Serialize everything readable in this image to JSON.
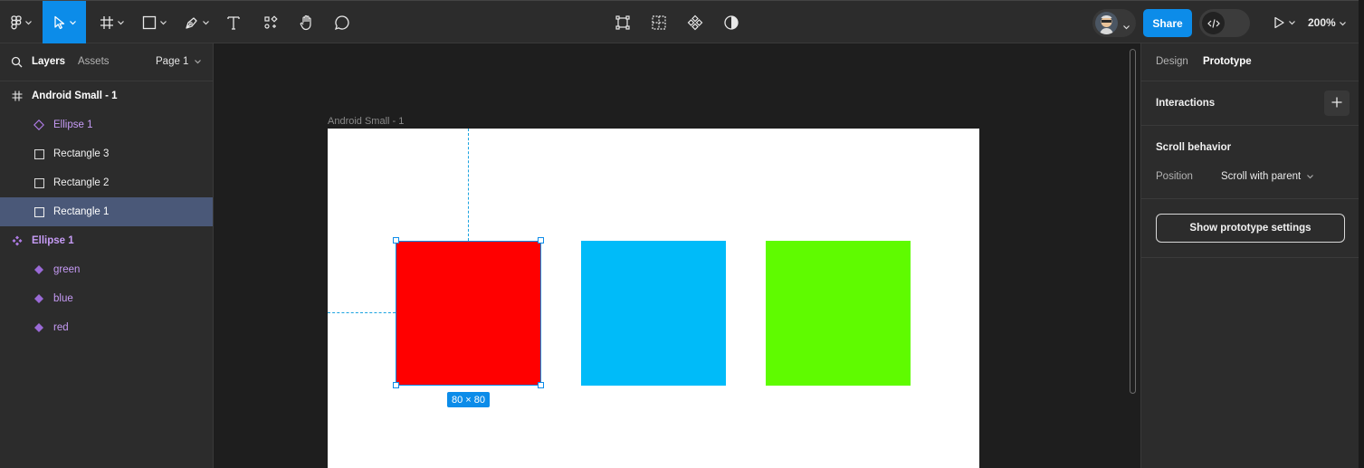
{
  "toolbar": {
    "share_label": "Share",
    "zoom_label": "200%",
    "accent": "#0c8ce9"
  },
  "left_panel": {
    "tab_layers": "Layers",
    "tab_assets": "Assets",
    "page_label": "Page 1",
    "layers": [
      {
        "label": "Android Small - 1",
        "icon": "frame-icon"
      },
      {
        "label": "Ellipse 1",
        "icon": "component-instance-icon"
      },
      {
        "label": "Rectangle 3",
        "icon": "rectangle-icon"
      },
      {
        "label": "Rectangle 2",
        "icon": "rectangle-icon"
      },
      {
        "label": "Rectangle 1",
        "icon": "rectangle-icon",
        "selected": true
      },
      {
        "label": "Ellipse 1",
        "icon": "component-set-icon"
      },
      {
        "label": "green",
        "icon": "component-variant-icon"
      },
      {
        "label": "blue",
        "icon": "component-variant-icon"
      },
      {
        "label": "red",
        "icon": "component-variant-icon"
      }
    ]
  },
  "canvas": {
    "frame_label": "Android Small - 1",
    "dimensions_label": "80 × 80",
    "squares": [
      {
        "name": "Rectangle 1",
        "color": "#ff0000"
      },
      {
        "name": "Rectangle 2",
        "color": "#00bbf9"
      },
      {
        "name": "Rectangle 3",
        "color": "#5ffb00"
      }
    ]
  },
  "right_panel": {
    "tab_design": "Design",
    "tab_prototype": "Prototype",
    "interactions_title": "Interactions",
    "scroll_title": "Scroll behavior",
    "position_label": "Position",
    "position_value": "Scroll with parent",
    "prototype_settings_label": "Show prototype settings"
  }
}
